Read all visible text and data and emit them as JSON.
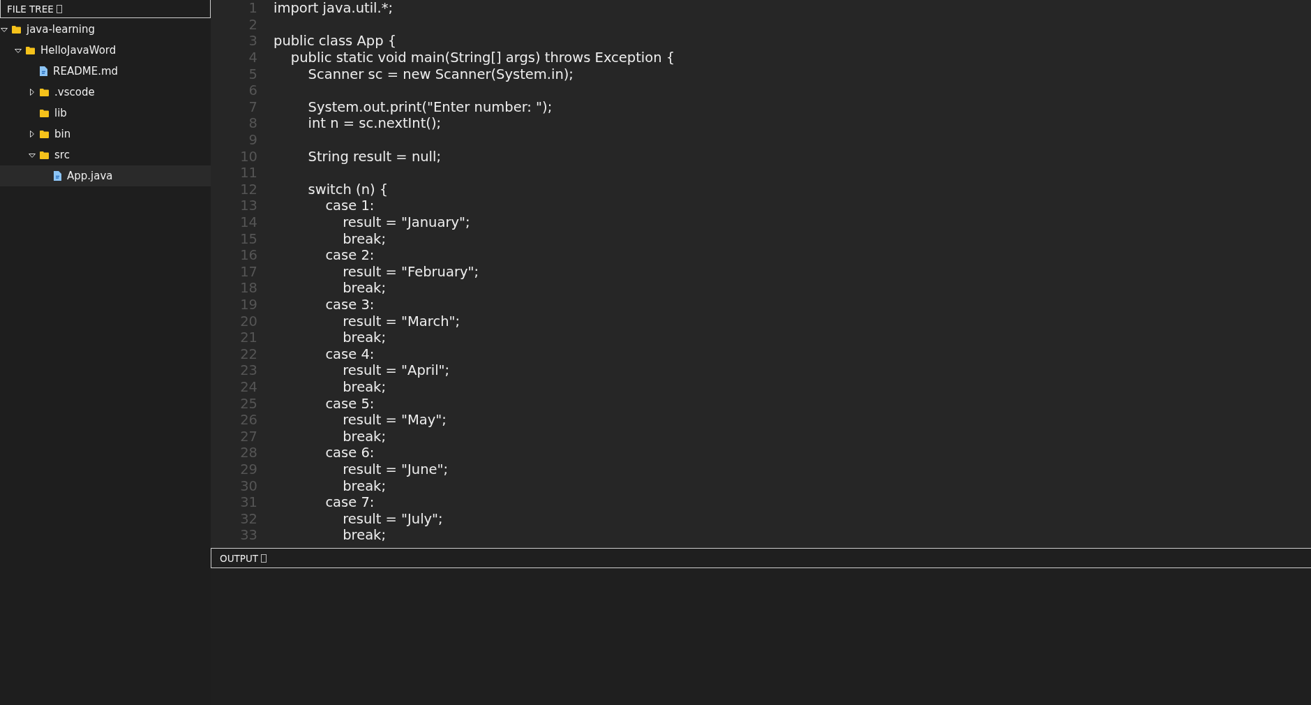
{
  "file_tree": {
    "title": "FILE TREE",
    "items": [
      {
        "label": "java-learning",
        "kind": "folder",
        "expanded": true,
        "selected": false,
        "children": [
          {
            "label": "HelloJavaWord",
            "kind": "folder",
            "expanded": true,
            "selected": false,
            "children": [
              {
                "label": "README.md",
                "kind": "file",
                "selected": false
              },
              {
                "label": ".vscode",
                "kind": "folder",
                "expanded": false,
                "selected": false
              },
              {
                "label": "lib",
                "kind": "folder",
                "selected": false
              },
              {
                "label": "bin",
                "kind": "folder",
                "expanded": false,
                "selected": false
              },
              {
                "label": "src",
                "kind": "folder",
                "expanded": true,
                "selected": false,
                "children": [
                  {
                    "label": "App.java",
                    "kind": "file",
                    "selected": true
                  }
                ]
              }
            ]
          }
        ]
      }
    ]
  },
  "editor": {
    "lines": [
      {
        "number": "1",
        "code": "import java.util.*;"
      },
      {
        "number": "2"
      },
      {
        "number": "3",
        "code": "public class App {"
      },
      {
        "number": "4",
        "code": "    public static void main(String[] args) throws Exception {"
      },
      {
        "number": "5",
        "code": "        Scanner sc = new Scanner(System.in);"
      },
      {
        "number": "6"
      },
      {
        "number": "7",
        "code": "        System.out.print(\"Enter number: \");"
      },
      {
        "number": "8",
        "code": "        int n = sc.nextInt();"
      },
      {
        "number": "9"
      },
      {
        "number": "10",
        "code": "        String result = null;"
      },
      {
        "number": "11"
      },
      {
        "number": "12",
        "code": "        switch (n) {"
      },
      {
        "number": "13",
        "code": "            case 1:"
      },
      {
        "number": "14",
        "code": "                result = \"January\";"
      },
      {
        "number": "15",
        "code": "                break;"
      },
      {
        "number": "16",
        "code": "            case 2:"
      },
      {
        "number": "17",
        "code": "                result = \"February\";"
      },
      {
        "number": "18",
        "code": "                break;"
      },
      {
        "number": "19",
        "code": "            case 3:"
      },
      {
        "number": "20",
        "code": "                result = \"March\";"
      },
      {
        "number": "21",
        "code": "                break;"
      },
      {
        "number": "22",
        "code": "            case 4:"
      },
      {
        "number": "23",
        "code": "                result = \"April\";"
      },
      {
        "number": "24",
        "code": "                break;"
      },
      {
        "number": "25",
        "code": "            case 5:"
      },
      {
        "number": "26",
        "code": "                result = \"May\";"
      },
      {
        "number": "27",
        "code": "                break;"
      },
      {
        "number": "28",
        "code": "            case 6:"
      },
      {
        "number": "29",
        "code": "                result = \"June\";"
      },
      {
        "number": "30",
        "code": "                break;"
      },
      {
        "number": "31",
        "code": "            case 7:"
      },
      {
        "number": "32",
        "code": "                result = \"July\";"
      },
      {
        "number": "33",
        "code": "                break;"
      }
    ]
  },
  "output": {
    "title": "OUTPUT"
  }
}
